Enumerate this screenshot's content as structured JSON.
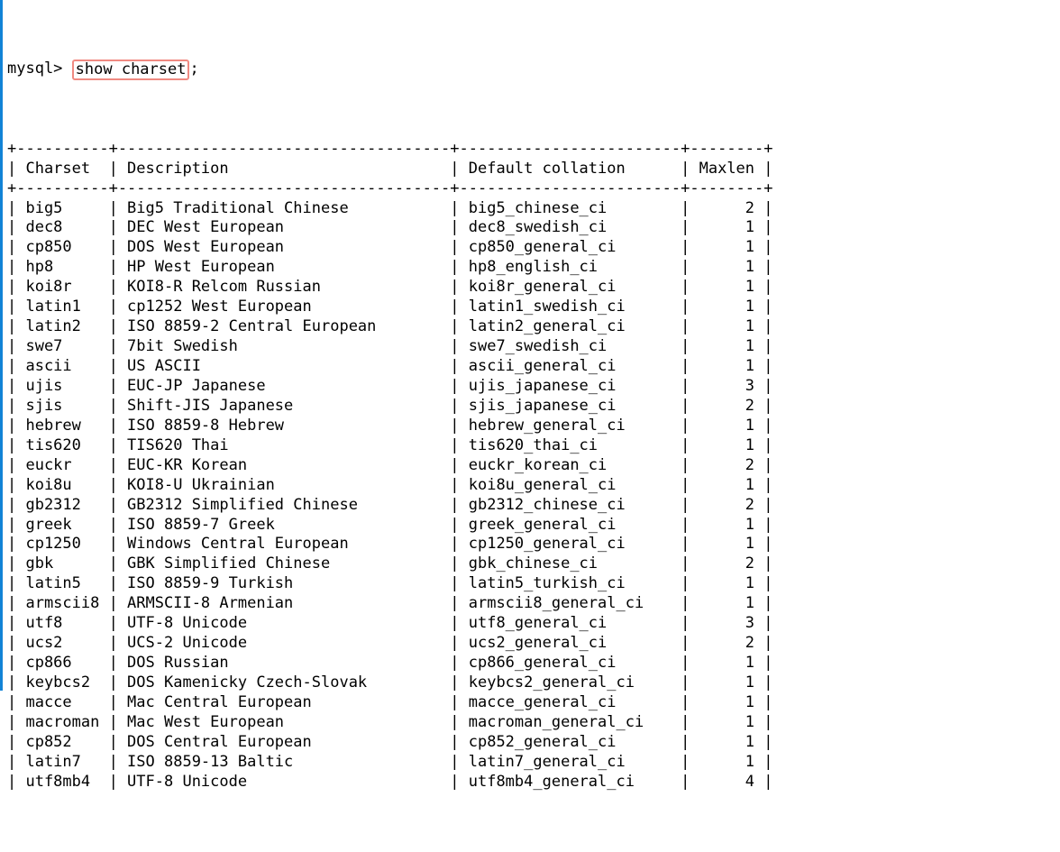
{
  "terminal": {
    "prompt": "mysql> ",
    "command": "show charset",
    "terminator": ";",
    "accent_blue": "#1283d6",
    "highlight_border": "#f08a82",
    "text_color": "#000000",
    "background": "#ffffff"
  },
  "table": {
    "columns": [
      {
        "header": "Charset",
        "width": 10,
        "align": "left"
      },
      {
        "header": "Description",
        "width": 36,
        "align": "left"
      },
      {
        "header": "Default collation",
        "width": 24,
        "align": "left"
      },
      {
        "header": "Maxlen",
        "width": 8,
        "align": "right"
      }
    ],
    "rows": [
      [
        "big5",
        "Big5 Traditional Chinese",
        "big5_chinese_ci",
        "2"
      ],
      [
        "dec8",
        "DEC West European",
        "dec8_swedish_ci",
        "1"
      ],
      [
        "cp850",
        "DOS West European",
        "cp850_general_ci",
        "1"
      ],
      [
        "hp8",
        "HP West European",
        "hp8_english_ci",
        "1"
      ],
      [
        "koi8r",
        "KOI8-R Relcom Russian",
        "koi8r_general_ci",
        "1"
      ],
      [
        "latin1",
        "cp1252 West European",
        "latin1_swedish_ci",
        "1"
      ],
      [
        "latin2",
        "ISO 8859-2 Central European",
        "latin2_general_ci",
        "1"
      ],
      [
        "swe7",
        "7bit Swedish",
        "swe7_swedish_ci",
        "1"
      ],
      [
        "ascii",
        "US ASCII",
        "ascii_general_ci",
        "1"
      ],
      [
        "ujis",
        "EUC-JP Japanese",
        "ujis_japanese_ci",
        "3"
      ],
      [
        "sjis",
        "Shift-JIS Japanese",
        "sjis_japanese_ci",
        "2"
      ],
      [
        "hebrew",
        "ISO 8859-8 Hebrew",
        "hebrew_general_ci",
        "1"
      ],
      [
        "tis620",
        "TIS620 Thai",
        "tis620_thai_ci",
        "1"
      ],
      [
        "euckr",
        "EUC-KR Korean",
        "euckr_korean_ci",
        "2"
      ],
      [
        "koi8u",
        "KOI8-U Ukrainian",
        "koi8u_general_ci",
        "1"
      ],
      [
        "gb2312",
        "GB2312 Simplified Chinese",
        "gb2312_chinese_ci",
        "2"
      ],
      [
        "greek",
        "ISO 8859-7 Greek",
        "greek_general_ci",
        "1"
      ],
      [
        "cp1250",
        "Windows Central European",
        "cp1250_general_ci",
        "1"
      ],
      [
        "gbk",
        "GBK Simplified Chinese",
        "gbk_chinese_ci",
        "2"
      ],
      [
        "latin5",
        "ISO 8859-9 Turkish",
        "latin5_turkish_ci",
        "1"
      ],
      [
        "armscii8",
        "ARMSCII-8 Armenian",
        "armscii8_general_ci",
        "1"
      ],
      [
        "utf8",
        "UTF-8 Unicode",
        "utf8_general_ci",
        "3"
      ],
      [
        "ucs2",
        "UCS-2 Unicode",
        "ucs2_general_ci",
        "2"
      ],
      [
        "cp866",
        "DOS Russian",
        "cp866_general_ci",
        "1"
      ],
      [
        "keybcs2",
        "DOS Kamenicky Czech-Slovak",
        "keybcs2_general_ci",
        "1"
      ],
      [
        "macce",
        "Mac Central European",
        "macce_general_ci",
        "1"
      ],
      [
        "macroman",
        "Mac West European",
        "macroman_general_ci",
        "1"
      ],
      [
        "cp852",
        "DOS Central European",
        "cp852_general_ci",
        "1"
      ],
      [
        "latin7",
        "ISO 8859-13 Baltic",
        "latin7_general_ci",
        "1"
      ],
      [
        "utf8mb4",
        "UTF-8 Unicode",
        "utf8mb4_general_ci",
        "4"
      ]
    ]
  }
}
